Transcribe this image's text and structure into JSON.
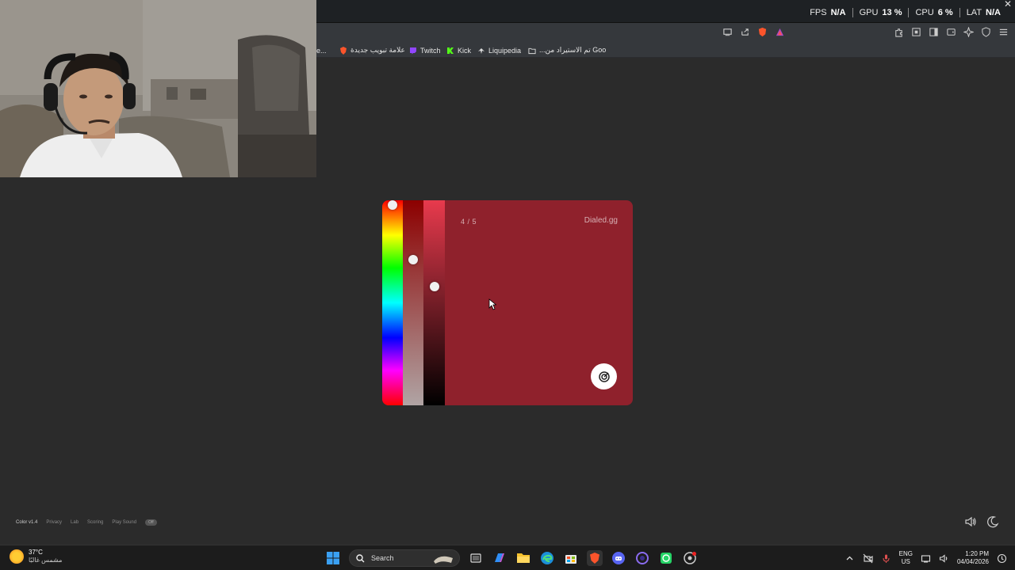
{
  "osd": {
    "fps_label": "FPS",
    "fps_value": "N/A",
    "gpu_label": "GPU",
    "gpu_value": "13 %",
    "cpu_label": "CPU",
    "cpu_value": "6 %",
    "lat_label": "LAT",
    "lat_value": "N/A",
    "close": "✕"
  },
  "bookmarks": [
    {
      "label": "e...",
      "icon": "truncated-bookmark"
    },
    {
      "label": "علامة تبويب جديدة",
      "icon": "brave-icon",
      "color": "#fb542b"
    },
    {
      "label": "Twitch",
      "icon": "twitch-icon",
      "color": "#9146ff"
    },
    {
      "label": "Kick",
      "icon": "kick-icon",
      "color": "#53fc18"
    },
    {
      "label": "Liquipedia",
      "icon": "liquipedia-icon",
      "color": "#cccccc"
    },
    {
      "label": "...تم الاستيراد من Goo",
      "icon": "folder-icon",
      "color": "#cccccc"
    }
  ],
  "game": {
    "round": "4 / 5",
    "brand": "Dialed.gg",
    "card_color": "#8f212c",
    "hue_level": 0.01,
    "saturation_level": 0.29,
    "brightness_level": 0.42
  },
  "footer": {
    "items": [
      "Color v1.4",
      "Privacy",
      "Lab",
      "Scoring",
      "Play Sound"
    ],
    "pill": "Off"
  },
  "taskbar": {
    "temperature": "37°C",
    "weather_desc": "مشمس غالبًا",
    "search_label": "Search",
    "lang_top": "ENG",
    "lang_bottom": "US",
    "time": "1:20 PM",
    "date": "04/04/2026",
    "apps": [
      "start-icon",
      "search-input",
      "task-view-icon",
      "copilot-icon",
      "file-explorer-icon",
      "edge-icon",
      "store-icon",
      "brave-icon",
      "discord-icon",
      "app-icon",
      "whatsapp-icon",
      "chrome-icon"
    ]
  }
}
